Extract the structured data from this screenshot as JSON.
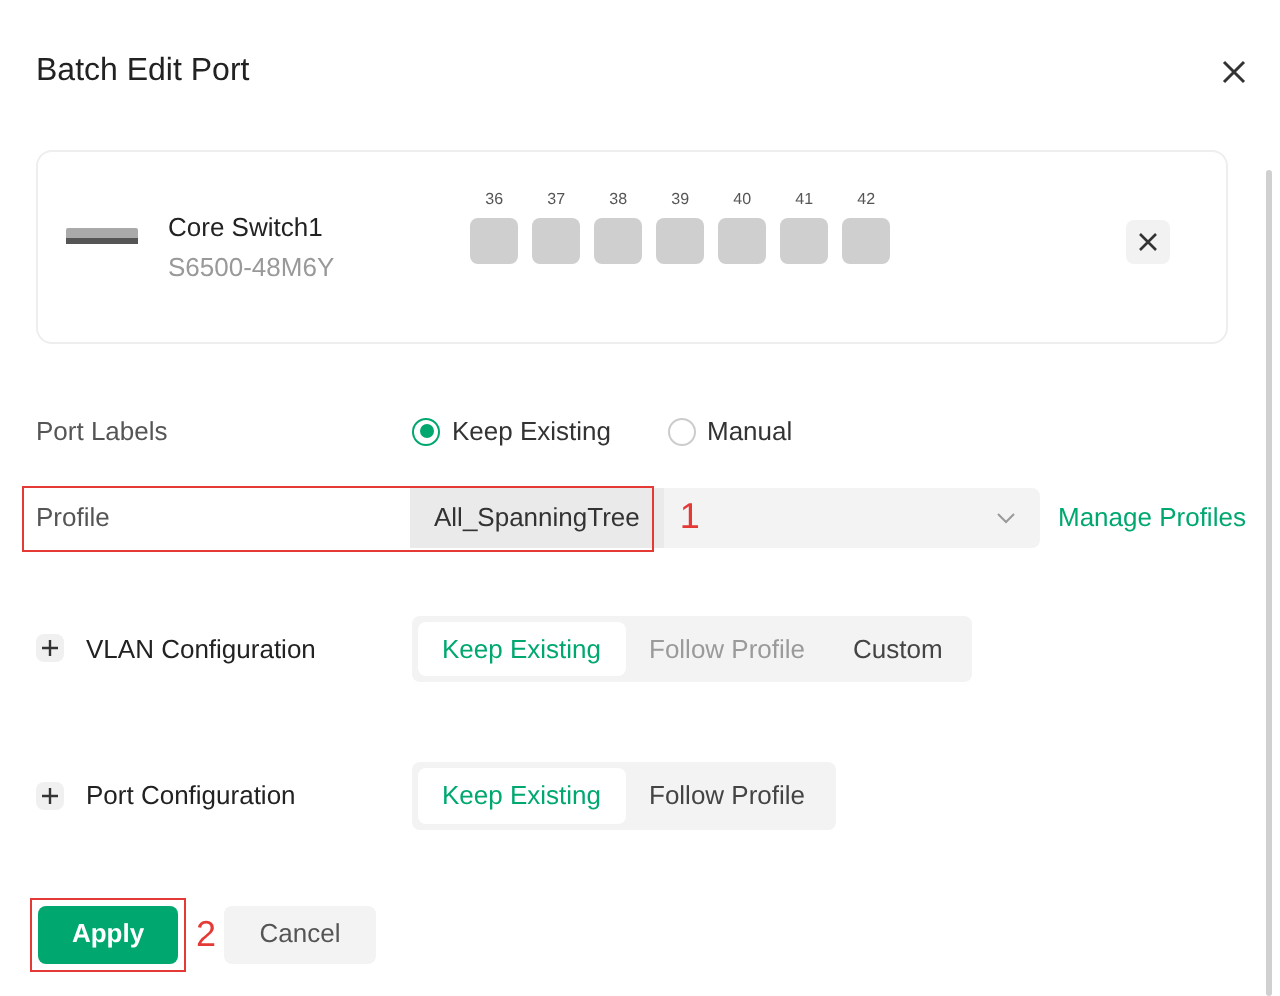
{
  "dialog": {
    "title": "Batch Edit Port"
  },
  "device": {
    "name": "Core Switch1",
    "model": "S6500-48M6Y",
    "ports": [
      "36",
      "37",
      "38",
      "39",
      "40",
      "41",
      "42"
    ]
  },
  "port_labels": {
    "label": "Port Labels",
    "options": [
      {
        "label": "Keep Existing",
        "selected": true
      },
      {
        "label": "Manual",
        "selected": false
      }
    ]
  },
  "profile": {
    "label": "Profile",
    "value": "All_SpanningTree",
    "annotation": "1",
    "link": "Manage Profiles"
  },
  "sections": [
    {
      "label": "VLAN Configuration",
      "expanded": false,
      "options": [
        {
          "label": "Keep Existing",
          "selected": true,
          "disabled": false
        },
        {
          "label": "Follow Profile",
          "selected": false,
          "disabled": true
        },
        {
          "label": "Custom",
          "selected": false,
          "disabled": false
        }
      ]
    },
    {
      "label": "Port Configuration",
      "expanded": false,
      "options": [
        {
          "label": "Keep Existing",
          "selected": true,
          "disabled": false
        },
        {
          "label": "Follow Profile",
          "selected": false,
          "disabled": false
        }
      ]
    }
  ],
  "footer": {
    "apply": "Apply",
    "annotation": "2",
    "cancel": "Cancel"
  }
}
